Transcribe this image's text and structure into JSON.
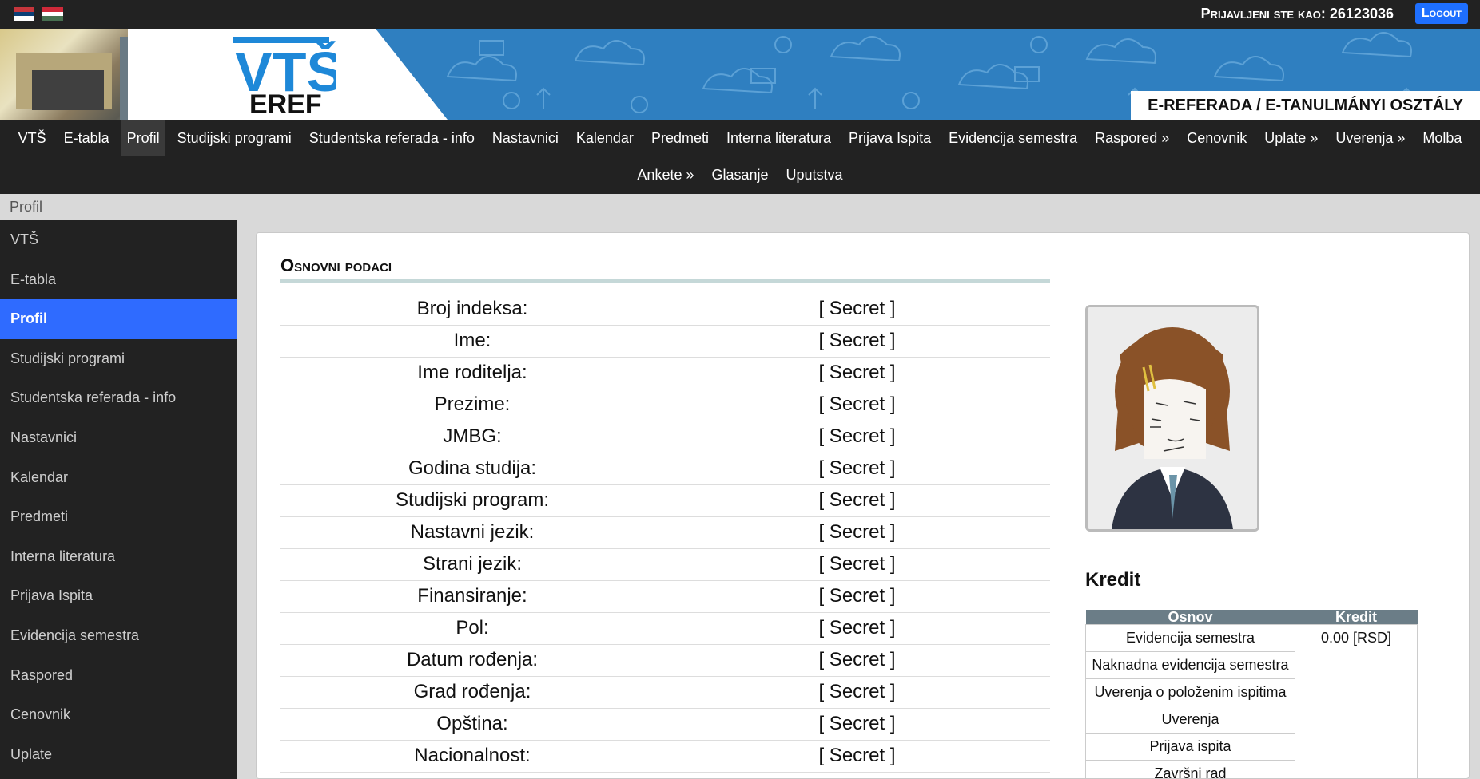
{
  "header": {
    "login_label": "Prijavljeni ste kao: 26123036",
    "logout_label": "Logout",
    "flags": [
      "serbia-flag-icon",
      "hungary-flag-icon"
    ]
  },
  "banner": {
    "logo_top": "VTŠ",
    "logo_bottom": "EREF",
    "title": "E-REFERADA / E-TANULMÁNYI OSZTÁLY"
  },
  "nav": {
    "row1": [
      "VTŠ",
      "E-tabla",
      "Profil",
      "Studijski programi",
      "Studentska referada - info",
      "Nastavnici",
      "Kalendar",
      "Predmeti",
      "Interna literatura",
      "Prijava Ispita",
      "Evidencija semestra",
      "Raspored »",
      "Cenovnik",
      "Uplate »",
      "Uverenja »",
      "Molba"
    ],
    "row2": [
      "Ankete »",
      "Glasanje",
      "Uputstva"
    ],
    "active": "Profil"
  },
  "breadcrumb": "Profil",
  "sidebar": {
    "items": [
      "VTŠ",
      "E-tabla",
      "Profil",
      "Studijski programi",
      "Studentska referada - info",
      "Nastavnici",
      "Kalendar",
      "Predmeti",
      "Interna literatura",
      "Prijava Ispita",
      "Evidencija semestra",
      "Raspored",
      "Cenovnik",
      "Uplate"
    ],
    "active": "Profil"
  },
  "profile": {
    "section_title": "Osnovni podaci",
    "fields": [
      {
        "label": "Broj indeksa:",
        "value": "[ Secret ]"
      },
      {
        "label": "Ime:",
        "value": "[ Secret ]"
      },
      {
        "label": "Ime roditelja:",
        "value": "[ Secret ]"
      },
      {
        "label": "Prezime:",
        "value": "[ Secret ]"
      },
      {
        "label": "JMBG:",
        "value": "[ Secret ]"
      },
      {
        "label": "Godina studija:",
        "value": "[ Secret ]"
      },
      {
        "label": "Studijski program:",
        "value": "[ Secret ]"
      },
      {
        "label": "Nastavni jezik:",
        "value": "[ Secret ]"
      },
      {
        "label": "Strani jezik:",
        "value": "[ Secret ]"
      },
      {
        "label": "Finansiranje:",
        "value": "[ Secret ]"
      },
      {
        "label": "Pol:",
        "value": "[ Secret ]"
      },
      {
        "label": "Datum rođenja:",
        "value": "[ Secret ]"
      },
      {
        "label": "Grad rođenja:",
        "value": "[ Secret ]"
      },
      {
        "label": "Opština:",
        "value": "[ Secret ]"
      },
      {
        "label": "Nacionalnost:",
        "value": "[ Secret ]"
      }
    ]
  },
  "kredit": {
    "title": "Kredit",
    "headers": [
      "Osnov",
      "Kredit"
    ],
    "value": "0.00 [RSD]",
    "rows": [
      "Evidencija semestra",
      "Naknadna evidencija semestra",
      "Uverenja o položenim ispitima",
      "Uverenja",
      "Prijava ispita",
      "Završni rad"
    ]
  },
  "colors": {
    "topbar": "#222222",
    "accent": "#2f6bff",
    "logout": "#1e6fff",
    "banner": "#2f7fc0",
    "table_header": "#6b7d87"
  }
}
